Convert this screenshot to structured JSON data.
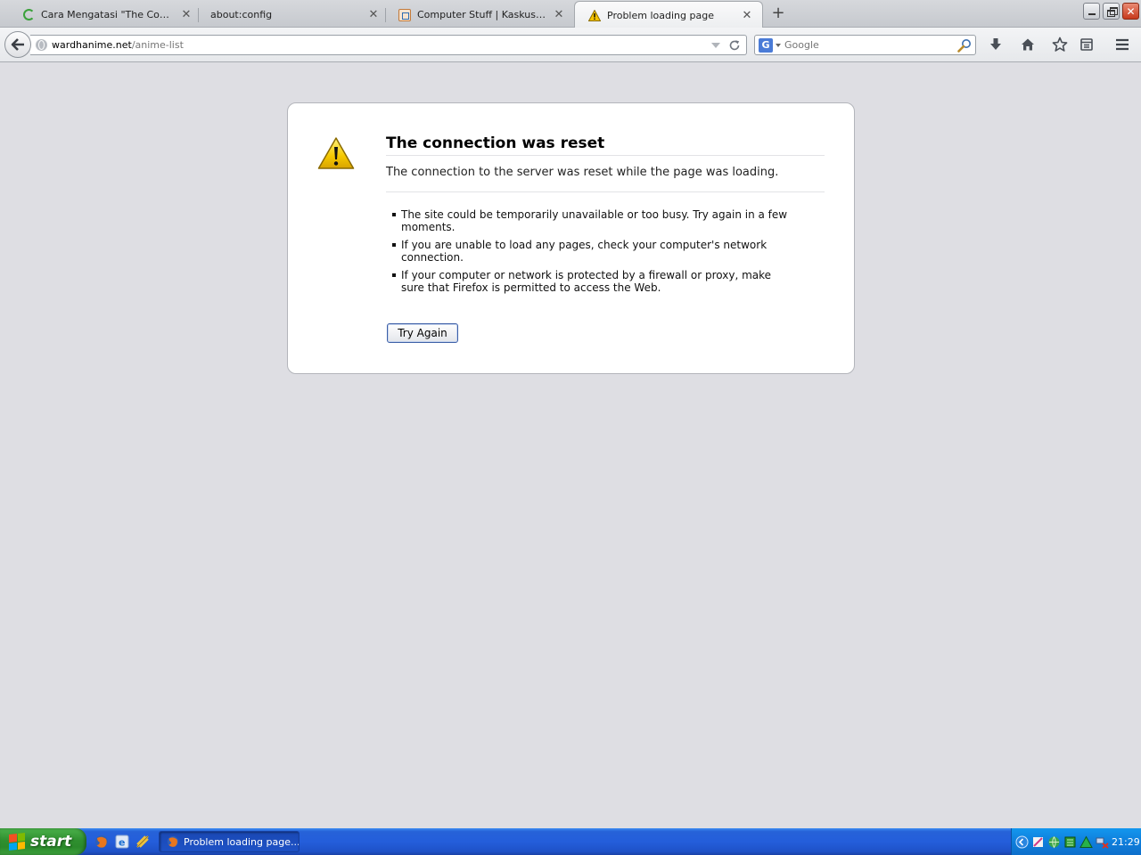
{
  "tabs": [
    {
      "label": "Cara Mengatasi \"The Connect...",
      "icon": "loading-spinner-icon",
      "active": false
    },
    {
      "label": "about:config",
      "icon": "none",
      "active": false
    },
    {
      "label": "Computer Stuff | Kaskus - Th...",
      "icon": "kaskus-favicon-icon",
      "active": false
    },
    {
      "label": "Problem loading page",
      "icon": "warning-icon",
      "active": true
    }
  ],
  "url": {
    "host": "wardhanime.net",
    "path": "/anime-list"
  },
  "search": {
    "placeholder": "Google",
    "engine": "G"
  },
  "error": {
    "title": "The connection was reset",
    "short": "The connection to the server was reset while the page was loading.",
    "items": [
      "The site could be temporarily unavailable or too busy. Try again in a few moments.",
      "If you are unable to load any pages, check your computer's network connection.",
      "If your computer or network is protected by a firewall or proxy, make sure that Firefox is permitted to access the Web."
    ],
    "button": "Try Again"
  },
  "taskbar": {
    "start_label": "start",
    "window_label": "Problem loading page...",
    "clock": "21:29"
  },
  "colors": {
    "content_bg": "#dedee3",
    "taskbar_blue": "#245edb",
    "start_green": "#2f8f2f"
  }
}
